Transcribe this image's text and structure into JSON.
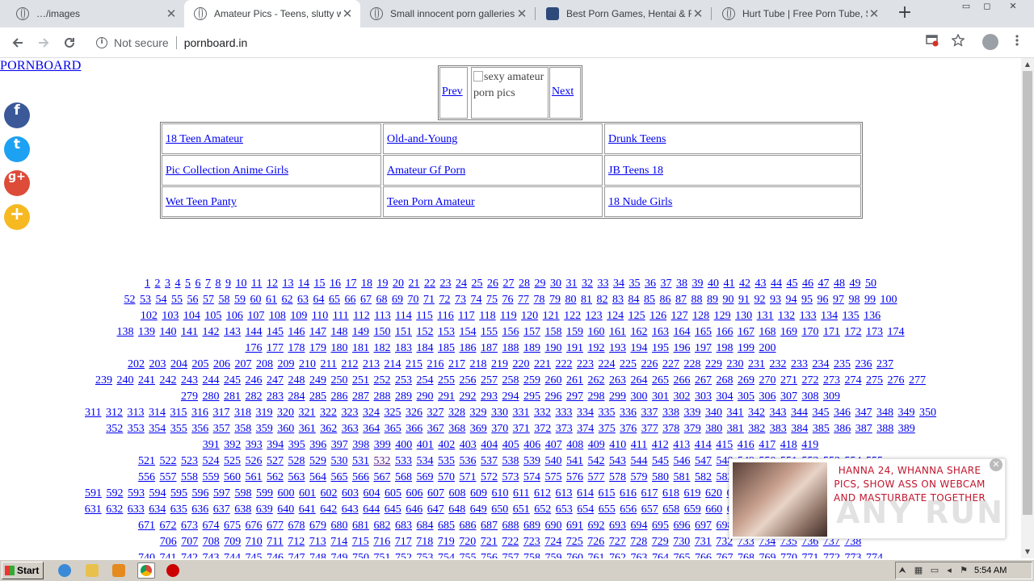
{
  "browser": {
    "tabs": [
      {
        "title": "…/images"
      },
      {
        "title": "Amateur Pics - Teens, slutty wife"
      },
      {
        "title": "Small innocent porn galleries"
      },
      {
        "title": "Best Porn Games, Hentai & Free"
      },
      {
        "title": "Hurt Tube | Free Porn Tube, Se"
      }
    ],
    "active_tab": 1,
    "tab_close_glyph": "✕",
    "new_tab_glyph": "+",
    "security_label": "Not secure",
    "url": "pornboard.in",
    "window_controls": [
      "▭",
      "◻",
      "✕"
    ]
  },
  "page": {
    "logo": "PORNBOARD",
    "share_buttons": [
      {
        "name": "facebook",
        "glyph": "f",
        "color": "#3b5998"
      },
      {
        "name": "twitter",
        "glyph": "t",
        "color": "#1da1f2"
      },
      {
        "name": "google-plus",
        "glyph": "g+",
        "color": "#dd4b39"
      },
      {
        "name": "more",
        "glyph": "+",
        "color": "#f6b922"
      }
    ],
    "pager": {
      "prev": "Prev",
      "image_alt": "sexy amateur porn pics",
      "next": "Next"
    },
    "gallery_links": [
      [
        "18 Teen Amateur",
        "Old-and-Young",
        "Drunk Teens"
      ],
      [
        "Pic Collection Anime Girls",
        "Amateur Gf Porn",
        "JB Teens 18"
      ],
      [
        "Wet Teen Panty",
        "Teen Porn Amateur",
        "18 Nude Girls"
      ]
    ],
    "page_number_ranges": [
      [
        1,
        419
      ],
      [
        521,
        774
      ]
    ],
    "visited_page": 532
  },
  "ad": {
    "text": "HANNA 24, WHANNA SHARE PICS, SHOW ASS ON WEBCAM AND MASTURBATE TOGETHER",
    "close_glyph": "✕",
    "watermark": "ANY RUN"
  },
  "taskbar": {
    "start_label": "Start",
    "clock": "5:54 AM"
  }
}
